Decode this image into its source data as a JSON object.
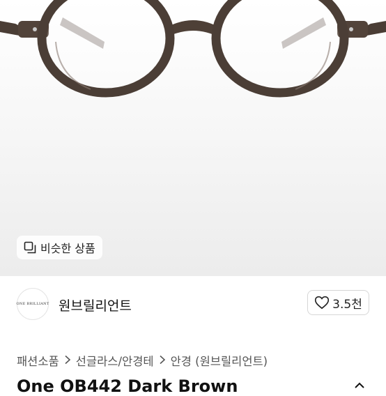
{
  "hero": {
    "similar_button_label": "비슷한 상품",
    "similar_icon": "similar-items-icon"
  },
  "shop": {
    "logo_text": "ONE BRILLIANT",
    "name": "원브릴리언트",
    "like_icon": "heart-icon",
    "like_count": "3.5천"
  },
  "breadcrumb": {
    "items": [
      "패션소품",
      "선글라스/안경테",
      "안경 (원브릴리언트)"
    ],
    "separator_icon": "chevron-right-icon"
  },
  "product": {
    "title": "One OB442 Dark Brown"
  }
}
